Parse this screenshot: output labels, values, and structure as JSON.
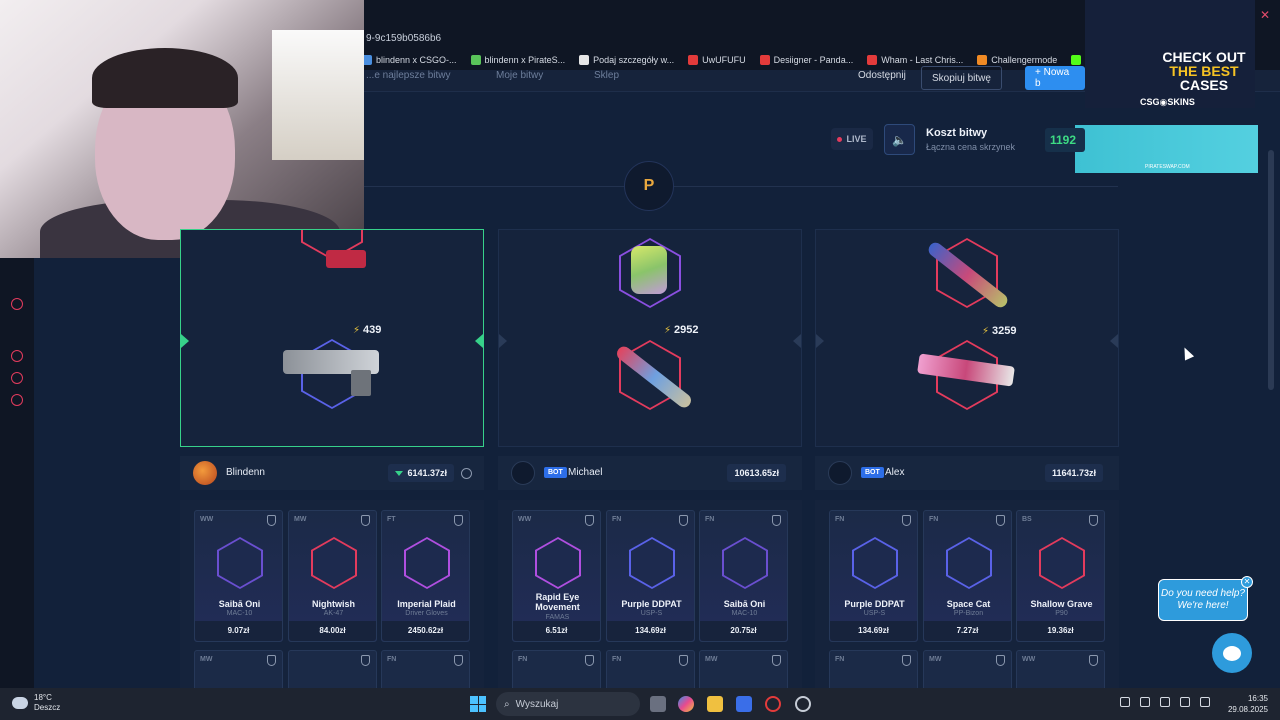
{
  "browser": {
    "url_fragment": "9-9c159b0586b6",
    "bookmarks": [
      {
        "label": "blindenn x CSGO-...",
        "color": "#4a8fe0"
      },
      {
        "label": "blindenn x PirateS...",
        "color": "#5ac45a"
      },
      {
        "label": "Podaj szczegóły w...",
        "color": "#e6e6e6"
      },
      {
        "label": "UwUFUFU",
        "color": "#e33b3b"
      },
      {
        "label": "Desiigner - Panda...",
        "color": "#e33b3b"
      },
      {
        "label": "Wham - Last Chris...",
        "color": "#e33b3b"
      },
      {
        "label": "Challengermode",
        "color": "#f08a24"
      },
      {
        "label": "Kickaway - Kick",
        "color": "#53fc18"
      }
    ]
  },
  "nav": {
    "best_battles": "...e najlepsze bitwy",
    "my_battles": "Moje bitwy",
    "shop": "Sklep",
    "share": "Odostępnij",
    "copy_battle": "Skopiuj bitwę",
    "new_battle": "+ Nowa b"
  },
  "ad": {
    "line1": "CHECK OUT",
    "line2": "THE BEST",
    "line3": "CASES",
    "brand": "CSG◉SKINS",
    "banner_small": "PIRATESWAP.COM"
  },
  "battle": {
    "live": "LIVE",
    "cost_title": "Koszt bitwy",
    "cost_sub": "Łączna cena skrzynek",
    "cost_value": "1192",
    "logo": "P"
  },
  "spinners": [
    {
      "value": "439",
      "top_color": "#e33b5d",
      "mid_color": "#5a62e8"
    },
    {
      "value": "2952",
      "top_color": "#8a4fe0",
      "mid_color": "#e33b5d"
    },
    {
      "value": "3259",
      "top_color": "#e33b5d",
      "mid_color": "#e33b5d"
    }
  ],
  "players": [
    {
      "name": "Blindenn",
      "total": "6141.37zł",
      "bot": ""
    },
    {
      "name": "Michael",
      "total": "10613.65zł",
      "bot": "BOT"
    },
    {
      "name": "Alex",
      "total": "11641.73zł",
      "bot": "BOT"
    }
  ],
  "items": [
    [
      {
        "cond": "WW",
        "name": "Saibā Oni",
        "sub": "MAC-10",
        "price": "9.07zł",
        "hex": "#6a4fd0"
      },
      {
        "cond": "MW",
        "name": "Nightwish",
        "sub": "AK-47",
        "price": "84.00zł",
        "hex": "#e33b5d"
      },
      {
        "cond": "FT",
        "name": "Imperial Plaid",
        "sub": "Driver Gloves",
        "price": "2450.62zł",
        "hex": "#b04fe0"
      }
    ],
    [
      {
        "cond": "WW",
        "name": "Rapid Eye Movement",
        "sub": "FAMAS",
        "price": "6.51zł",
        "hex": "#b04fe0"
      },
      {
        "cond": "FN",
        "name": "Purple DDPAT",
        "sub": "USP-S",
        "price": "134.69zł",
        "hex": "#5a62e8"
      },
      {
        "cond": "FN",
        "name": "Saibā Oni",
        "sub": "MAC-10",
        "price": "20.75zł",
        "hex": "#6a4fd0"
      }
    ],
    [
      {
        "cond": "FN",
        "name": "Purple DDPAT",
        "sub": "USP-S",
        "price": "134.69zł",
        "hex": "#5a62e8"
      },
      {
        "cond": "FN",
        "name": "Space Cat",
        "sub": "PP-Bizon",
        "price": "7.27zł",
        "hex": "#5a62e8"
      },
      {
        "cond": "BS",
        "name": "Shallow Grave",
        "sub": "P90",
        "price": "19.36zł",
        "hex": "#e33b5d"
      }
    ]
  ],
  "items_row2": [
    [
      "MW",
      "",
      "FN"
    ],
    [
      "FN",
      "FN",
      "MW"
    ],
    [
      "FN",
      "MW",
      "WW"
    ]
  ],
  "help": {
    "text1": "Do you need help?",
    "text2": "We're here!"
  },
  "taskbar": {
    "temp": "18°C",
    "weather": "Deszcz",
    "search": "Wyszukaj",
    "time": "16:35",
    "date": "29.08.2025"
  },
  "colors": {
    "accent_green": "#37d18a",
    "accent_red": "#e33b5d",
    "help_blue": "#2e9bdc"
  }
}
